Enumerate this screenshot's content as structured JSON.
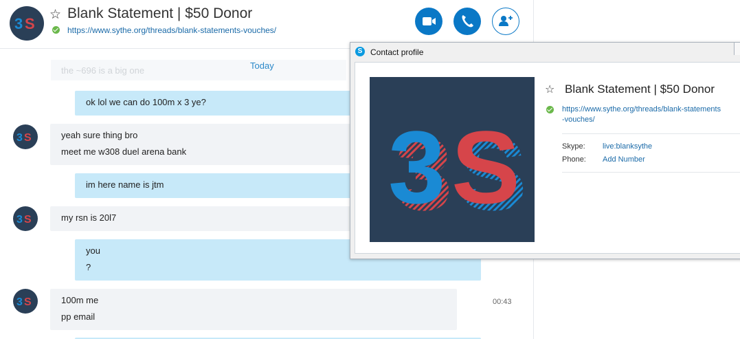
{
  "header": {
    "title": "Blank Statement | $50 Donor",
    "url": "https://www.sythe.org/threads/blank-statements-vouches/",
    "star_glyph": "☆",
    "buttons": {
      "video": "video-call-icon",
      "call": "phone-icon",
      "add": "add-contact-icon"
    }
  },
  "chat": {
    "ghost_text": "the ~696 is a big one",
    "date_divider": "Today",
    "messages": [
      {
        "dir": "out",
        "lines": [
          "ok lol we can do 100m x 3 ye?"
        ]
      },
      {
        "dir": "in",
        "lines": [
          "yeah sure thing bro",
          "meet me w308 duel arena bank"
        ]
      },
      {
        "dir": "out",
        "lines": [
          "im here name is jtm"
        ]
      },
      {
        "dir": "in",
        "lines": [
          "my rsn is 20l7"
        ]
      },
      {
        "dir": "out",
        "lines": [
          "you",
          "?"
        ]
      },
      {
        "dir": "in",
        "lines": [
          "100m me",
          "pp email"
        ],
        "time": "00:43"
      }
    ]
  },
  "profile_window": {
    "title": "Contact profile",
    "name": "Blank Statement | $50 Donor",
    "url_line1": "https://www.sythe.org/threads/blank-statements",
    "url_line2": "-vouches/",
    "skype_label": "Skype:",
    "skype_value": "live:blanksythe",
    "phone_label": "Phone:",
    "phone_value": "Add Number"
  },
  "colors": {
    "accent": "#0a78c6",
    "outgoing_bubble": "#c7e9f9",
    "incoming_bubble": "#f1f3f6",
    "online": "#6bb84b",
    "logo_blue": "#1a8ad4",
    "logo_red": "#d6454a",
    "logo_bg": "#2a3f57"
  }
}
